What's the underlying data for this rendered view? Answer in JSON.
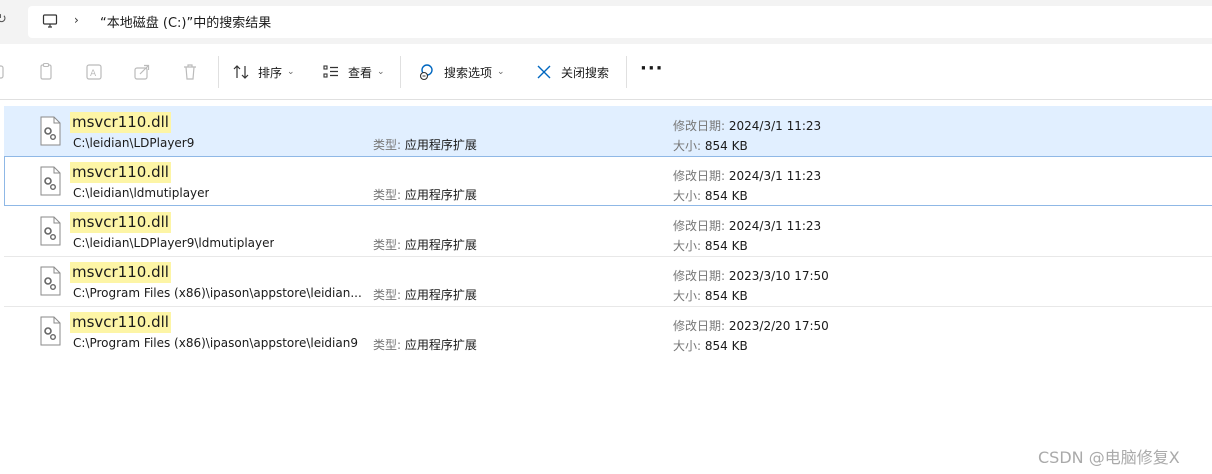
{
  "address": {
    "breadcrumb_sep": "›",
    "text": "“本地磁盘 (C:)”中的搜索结果"
  },
  "toolbar": {
    "sort_label": "排序",
    "view_label": "查看",
    "search_options_label": "搜索选项",
    "close_search_label": "关闭搜索",
    "more_label": "···",
    "dropdown_glyph": "⌄"
  },
  "results": [
    {
      "name": "msvcr110.dll",
      "path": "C:\\leidian\\LDPlayer9",
      "type_key": "类型:",
      "type": "应用程序扩展",
      "date_key": "修改日期:",
      "date": "2024/3/1 11:23",
      "size_key": "大小:",
      "size": "854 KB"
    },
    {
      "name": "msvcr110.dll",
      "path": "C:\\leidian\\ldmutiplayer",
      "type_key": "类型:",
      "type": "应用程序扩展",
      "date_key": "修改日期:",
      "date": "2024/3/1 11:23",
      "size_key": "大小:",
      "size": "854 KB"
    },
    {
      "name": "msvcr110.dll",
      "path": "C:\\leidian\\LDPlayer9\\ldmutiplayer",
      "type_key": "类型:",
      "type": "应用程序扩展",
      "date_key": "修改日期:",
      "date": "2024/3/1 11:23",
      "size_key": "大小:",
      "size": "854 KB"
    },
    {
      "name": "msvcr110.dll",
      "path": "C:\\Program Files (x86)\\ipason\\appstore\\leidian...",
      "type_key": "类型:",
      "type": "应用程序扩展",
      "date_key": "修改日期:",
      "date": "2023/3/10 17:50",
      "size_key": "大小:",
      "size": "854 KB"
    },
    {
      "name": "msvcr110.dll",
      "path": "C:\\Program Files (x86)\\ipason\\appstore\\leidian9",
      "type_key": "类型:",
      "type": "应用程序扩展",
      "date_key": "修改日期:",
      "date": "2023/2/20 17:50",
      "size_key": "大小:",
      "size": "854 KB"
    }
  ],
  "watermark": "CSDN @电脑修复X",
  "colors": {
    "selected_row": "#e1efff",
    "highlight": "#fdf5a6",
    "accent": "#0067c0"
  }
}
